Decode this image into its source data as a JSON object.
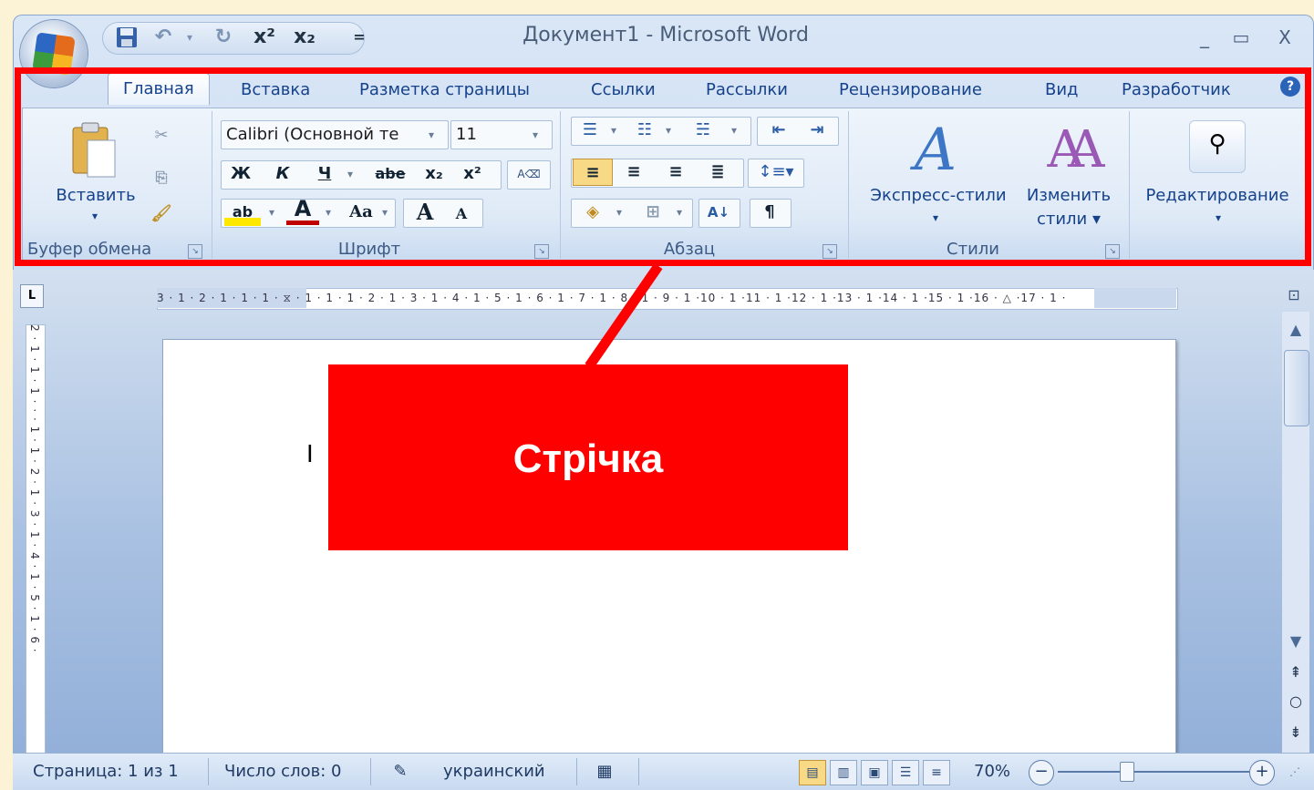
{
  "window": {
    "title": "Документ1 - Microsoft Word",
    "controls": {
      "minimize": "_",
      "maximize": "▭",
      "close": "X"
    }
  },
  "quick_access": {
    "save_icon": "floppy-disk-icon",
    "undo_icon": "undo-arrow-icon",
    "redo_icon": "redo-arrow-icon",
    "superscript": "x²",
    "subscript": "x₂",
    "customize": "="
  },
  "ribbon": {
    "tabs": [
      "Главная",
      "Вставка",
      "Разметка страницы",
      "Ссылки",
      "Рассылки",
      "Рецензирование",
      "Вид",
      "Разработчик"
    ],
    "active_tab": "Главная",
    "help_icon": "?",
    "clipboard": {
      "label": "Буфер обмена",
      "paste": "Вставить",
      "paste_arrow": "▾"
    },
    "font": {
      "label": "Шрифт",
      "font_name": "Calibri (Основной те",
      "font_size": "11",
      "bold": "Ж",
      "italic": "К",
      "underline": "Ч",
      "strike": "abe",
      "subscript": "x₂",
      "superscript": "x²",
      "change_case": "Aa",
      "grow": "A",
      "shrink": "A",
      "font_color": "A"
    },
    "paragraph": {
      "label": "Абзац",
      "sort": "А↓",
      "pilcrow": "¶"
    },
    "styles": {
      "label": "Стили",
      "quick_styles": "Экспресс-стили",
      "change_styles_1": "Изменить",
      "change_styles_2": "стили ▾"
    },
    "editing": {
      "label": "Редактирование",
      "arrow": "▾"
    }
  },
  "ruler": {
    "horizontal": "3 · 1 · 2 · 1 · 1 · 1 · ⧖ · 1 · 1 · 1 · 2 · 1 · 3 · 1 · 4 · 1 · 5 · 1 · 6 · 1 · 7 · 1 · 8 · 1 · 9 · 1 ·10 · 1 ·11 · 1 ·12 · 1 ·13 · 1 ·14 · 1 ·15 · 1 ·16 · △ ·17 · 1 ·",
    "vertical": "2 · 1 · 1 · 1 · · · 1 · 1 · 2 · 1 · 3 · 1 · 4 · 1 · 5 · 1 · 6 ·",
    "tab_selector": "L"
  },
  "document": {
    "cursor": "I"
  },
  "callout": {
    "text": "Стрічка",
    "color": "#ff0000"
  },
  "status": {
    "page": "Страница: 1 из 1",
    "words": "Число слов: 0",
    "language": "украинский",
    "zoom": "70%"
  }
}
